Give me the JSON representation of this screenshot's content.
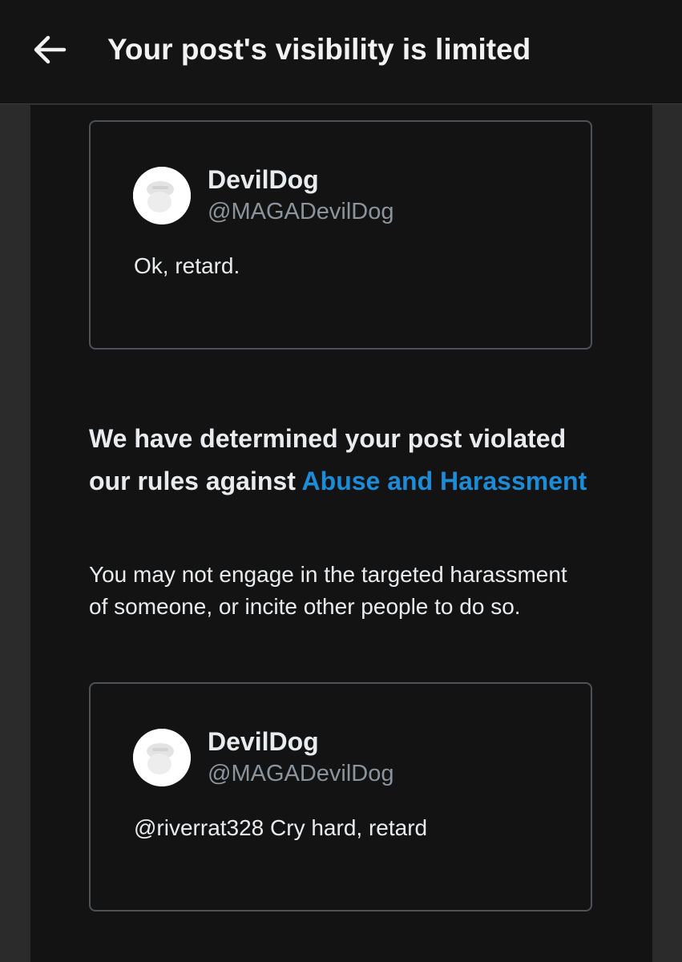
{
  "header": {
    "title": "Your post's visibility is limited",
    "back_icon": "arrow-left-icon"
  },
  "posts": [
    {
      "author_name": "DevilDog",
      "author_handle": "@MAGADevilDog",
      "text": "Ok, retard."
    },
    {
      "author_name": "DevilDog",
      "author_handle": "@MAGADevilDog",
      "text": "@riverrat328 Cry hard, retard"
    }
  ],
  "violation": {
    "heading_prefix": "We have determined your post violated our rules against ",
    "rule_link": "Abuse and Harassment",
    "description": "You may not engage in the targeted harassment of someone, or incite other people to do so."
  },
  "colors": {
    "background": "#131313",
    "link": "#1d8cd8",
    "text": "#e9ecef",
    "muted": "#8b949c",
    "card_border": "#4c5258"
  }
}
